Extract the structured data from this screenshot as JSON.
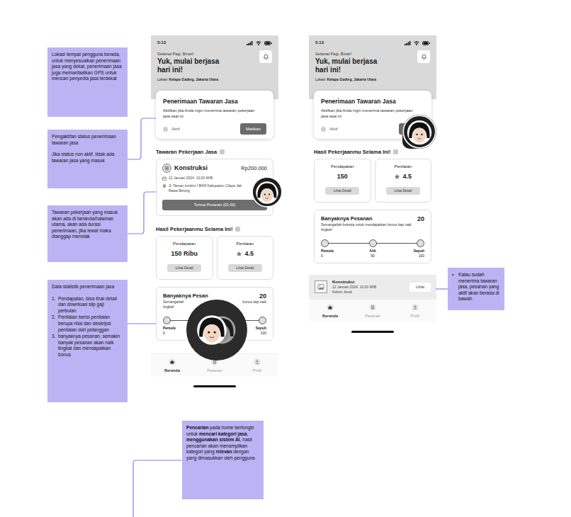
{
  "notes": {
    "location": "Lokasi tempat pengguna berada, untuk menyesuaikan penerimaan jasa yang dekat, penerimaan jasa juga memanfaatkan GPS untuk mencari penyedia jasa terdekat",
    "activation": [
      "Pengaktifan status penerimaan tawaran jasa",
      "Jika status non aktif, tidak ada tawaran jasa yang masuk"
    ],
    "offer": "Tawaran pekerjaan yang masuk akan ada di beranda/halaman utama, akan ada durasi penerimaan, jika lewat maka dianggap menolak",
    "stats": {
      "title": "Data statistik penerimaan jasa",
      "items": [
        {
          "marker": "1.",
          "text": "Pendapatan, bisa lihat detail dan download slip gaji perbulan"
        },
        {
          "marker": "2.",
          "text": "Penilaian berisi penilaian berupa nilai dan deskripsi penilaian dari pelanggan"
        },
        {
          "marker": "3.",
          "text": "banyaknya pesanan, semakin banyak pesanan akan naik tingkat dan mendapatkan bonus"
        }
      ]
    },
    "active_order": [
      {
        "marker": "•",
        "text": "Kalau sudah menerima tawaran jasa, pesanan yang aktif akan berada di bawah"
      }
    ],
    "search": [
      {
        "text": "Pencarian",
        "bold": true
      },
      {
        "text": " pada home berfungsi untuk ",
        "bold": false
      },
      {
        "text": "mencari kategori jasa",
        "bold": true
      },
      {
        "text": ", ",
        "bold": false
      },
      {
        "text": "menggunakan sistem AI",
        "bold": true
      },
      {
        "text": ", hasil pencarian akan menampilkan kategori yang ",
        "bold": false
      },
      {
        "text": "relevan",
        "bold": true
      },
      {
        "text": " dengan yang dimasukkan oleh pengguna",
        "bold": false
      }
    ]
  },
  "phones": [
    {
      "status_time": "5:13",
      "greeting": "Selamat Pagi, Binari!",
      "headline": "Yuk, mulai berjasa hari ini!",
      "location_label": "Lokasi",
      "location": "Kelapa Gading, Jakarta Utara",
      "acceptance": {
        "title": "Penerimaan Tawaran Jasa",
        "desc": "Aktifkan jika Anda ingin menerima tawaran pekerjaan jasa saat ini",
        "status_label": "Aktif",
        "checked": false,
        "button": "Matikan"
      },
      "offer": {
        "section": "Tawaran Pekerjaan Jasa",
        "category": "Konstruksi",
        "price": "Rp200.000",
        "date": "12 Januari 2024, 10:20 WIB",
        "address": [
          "Jl. Taman lumbini I B4/8 Kabupaten Cilaya Jak",
          "Rawa Belong"
        ],
        "button": "Terima Pesanan (01:00)"
      },
      "stats": {
        "section": "Hasil Pekerjaanmu Selama Ini!",
        "cards": [
          {
            "label": "Pendapatan",
            "value": "150 Ribu",
            "button": "Lihat Detail",
            "kind": "plain"
          },
          {
            "label": "Penilaian",
            "value": "4.5",
            "button": "Lihat Detail",
            "kind": "rating"
          }
        ]
      },
      "orders": {
        "title": "Banyaknya Pesan",
        "count": "20",
        "desc": [
          [
            "Semangatlah",
            "bonus tiap naik"
          ],
          [
            "tingkat!"
          ]
        ],
        "levels": [
          {
            "label": "Pemula",
            "value": "0"
          },
          {
            "label": "Sepuh",
            "value": "100"
          }
        ]
      },
      "nav": [
        {
          "label": "Beranda",
          "selected": true
        },
        {
          "label": "Pesanan",
          "selected": false
        },
        {
          "label": "Profil",
          "selected": false
        }
      ]
    },
    {
      "status_time": "5:13",
      "greeting": "Selamat Pagi, Binari!",
      "headline": "Yuk, mulai berjasa hari ini!",
      "location_label": "Lokasi",
      "location": "Kelapa Gading, Jakarta Utara",
      "acceptance": {
        "title": "Penerimaan Tawaran Jasa",
        "desc": "Aktifkan jika Anda ingin menerima tawaran pekerjaan jasa saat ini",
        "status_label": "Aktif",
        "checked": false
      },
      "stats": {
        "section": "Hasil Pekerjaanmu Selama Ini!",
        "cards": [
          {
            "label": "Pendapatan",
            "value": "150",
            "button": "Lihat Detail",
            "kind": "plain"
          },
          {
            "label": "Penilaian",
            "value": "4.5",
            "button": "Lihat Detail",
            "kind": "rating"
          }
        ]
      },
      "orders": {
        "title": "Banyaknya Pesanan",
        "count": "20",
        "desc": [
          [
            "Semangatlah bekerja untuk mendapatkan bonus tiap naik"
          ],
          [
            "tingkat!"
          ]
        ],
        "levels": [
          {
            "label": "Pemula",
            "value": "0"
          },
          {
            "label": "Ahli",
            "value": "50"
          },
          {
            "label": "Sepuh",
            "value": "100"
          }
        ]
      },
      "active_order": {
        "category": "Konstruksi",
        "date": "12 Januari 2024, 10:20 WIB",
        "place": "Kebon Jeruk",
        "button": "Lihat"
      },
      "nav": [
        {
          "label": "Beranda",
          "selected": true
        },
        {
          "label": "Pesanan",
          "selected": false
        },
        {
          "label": "Profil",
          "selected": false
        }
      ]
    }
  ]
}
